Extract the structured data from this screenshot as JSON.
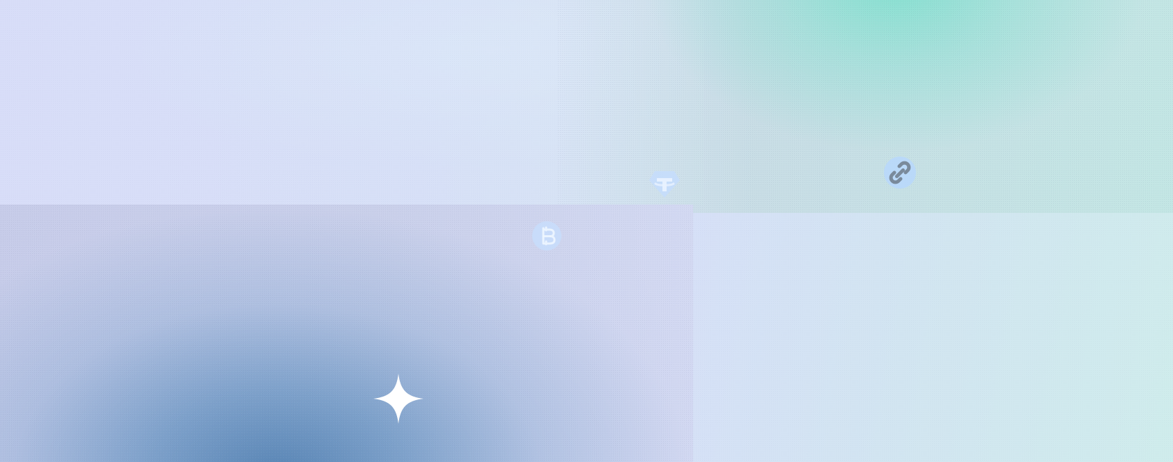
{
  "background": {
    "base_color": "#d8ddf8",
    "accent_teal": "#82e0cf",
    "accent_blue": "#5281b2"
  },
  "icons": {
    "tether": "tether-icon",
    "link": "link-icon",
    "bitcoin": "bitcoin-icon",
    "sparkle": "sparkle-icon"
  }
}
